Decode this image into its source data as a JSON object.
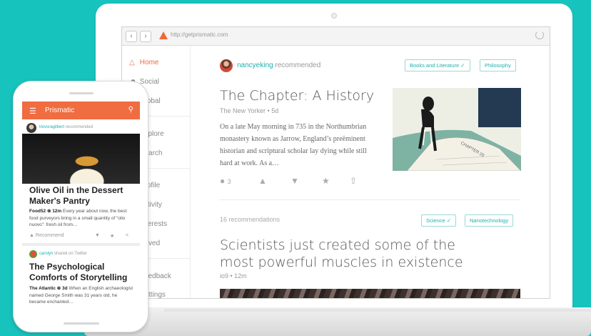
{
  "browser": {
    "url": "http://getprismatic.com"
  },
  "sidebar": {
    "items": [
      {
        "label": "Home",
        "icon": "prismatic-icon"
      },
      {
        "label": "Social",
        "icon": "people-icon"
      },
      {
        "label": "Global",
        "icon": "globe-icon"
      },
      {
        "label": "Explore",
        "icon": "compass-icon"
      },
      {
        "label": "Search",
        "icon": "search-icon"
      },
      {
        "label": "Profile",
        "icon": "user-icon"
      },
      {
        "label": "Activity",
        "icon": "activity-icon"
      },
      {
        "label": "Interests",
        "icon": "tag-icon"
      },
      {
        "label": "Saved",
        "icon": "bookmark-icon"
      },
      {
        "label": "Feedback",
        "icon": "chat-icon"
      },
      {
        "label": "Settings",
        "icon": "gear-icon"
      }
    ]
  },
  "feed": {
    "card1": {
      "recommender": "nancyeking",
      "action": "recommended",
      "tags": [
        "Books and Literature ✓",
        "Philosophy"
      ],
      "title": "The Chapter: A History",
      "source": "The New Yorker",
      "age": "5d",
      "excerpt": "On a late May morning in 735 in the Northumbrian monastery known as Jarrow, England’s preëminent historian and scriptural scholar lay dying while still hard at work. As a…",
      "comment_count": "3",
      "image_text": "CHAPTER 20"
    },
    "card2": {
      "recommendations": "16 recommendations",
      "tags": [
        "Science ✓",
        "Nanotechnology"
      ],
      "title": "Scientists just created some of the most powerful muscles in existence",
      "source": "io9",
      "age": "12m"
    }
  },
  "phone": {
    "app_title": "Prismatic",
    "card1": {
      "recommender": "trevoragilbert",
      "action": "recommended",
      "title": "Olive Oil in the Dessert Maker's Pantry",
      "source": "Food52",
      "age": "⊗ 12m",
      "excerpt": "Every year about now, the best food purveyors bring in a small quantity of “olio nuovo”: fresh oil from…",
      "recommend_label": "Recommend"
    },
    "card2": {
      "sharer": "carolyn",
      "action": "shared on Twitter",
      "title": "The Psychological Comforts of Storytelling",
      "source": "The Atlantic",
      "age": "⊗ 3d",
      "excerpt": "When an English archaeologist named George Smith was 31 years old, he became enchanted…"
    }
  },
  "colors": {
    "background": "#17c3bd",
    "accent": "#f06c41",
    "link": "#1eb1ad"
  }
}
